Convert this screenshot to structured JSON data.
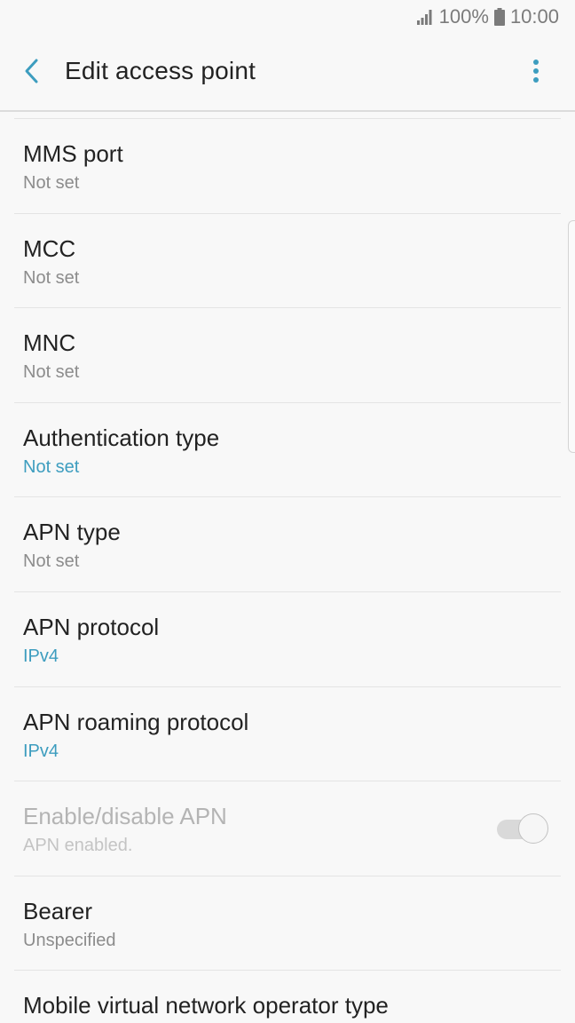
{
  "status_bar": {
    "battery_percent": "100%",
    "time": "10:00",
    "icons": [
      "signal-icon",
      "battery-icon"
    ]
  },
  "app_bar": {
    "title": "Edit access point",
    "back_icon": "chevron-left-icon",
    "more_icon": "more-vertical-icon"
  },
  "colors": {
    "accent": "#3d9dbf",
    "background": "#f8f8f8",
    "title_text": "#222222",
    "secondary_text": "#8c8c8c",
    "disabled_text": "#b4b4b4"
  },
  "settings": [
    {
      "title": "MMS port",
      "value": "Not set"
    },
    {
      "title": "MCC",
      "value": "Not set"
    },
    {
      "title": "MNC",
      "value": "Not set"
    },
    {
      "title": "Authentication type",
      "value": "Not set"
    },
    {
      "title": "APN type",
      "value": "Not set"
    },
    {
      "title": "APN protocol",
      "value": "IPv4"
    },
    {
      "title": "APN roaming protocol",
      "value": "IPv4"
    },
    {
      "title": "Enable/disable APN",
      "value": "APN enabled.",
      "toggle_on": true,
      "enabled": false
    },
    {
      "title": "Bearer",
      "value": "Unspecified"
    },
    {
      "title": "Mobile virtual network operator type",
      "value": ""
    }
  ]
}
